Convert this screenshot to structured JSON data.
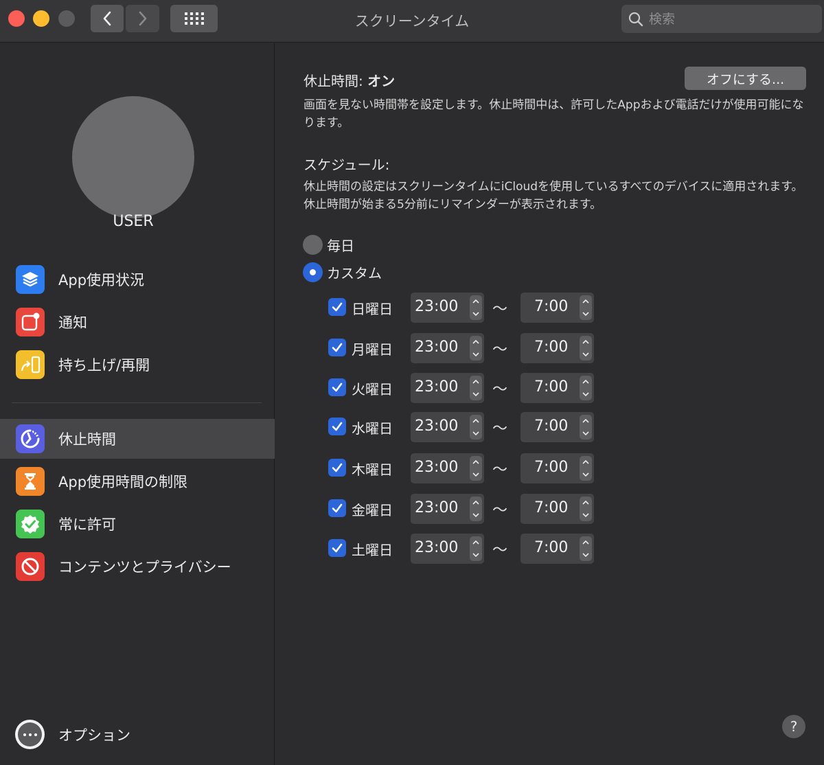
{
  "window": {
    "title": "スクリーンタイム"
  },
  "search": {
    "placeholder": "検索"
  },
  "user": {
    "name": "USER"
  },
  "sidebar": {
    "items": [
      {
        "label": "App使用状況",
        "icon": "layers-icon",
        "color": "#2d7cf0"
      },
      {
        "label": "通知",
        "icon": "notification-icon",
        "color": "#e9473e"
      },
      {
        "label": "持ち上げ/再開",
        "icon": "pickup-icon",
        "color": "#f2be2c"
      }
    ],
    "items2": [
      {
        "label": "休止時間",
        "icon": "downtime-icon",
        "color": "#5a5ee0",
        "selected": true
      },
      {
        "label": "App使用時間の制限",
        "icon": "hourglass-icon",
        "color": "#f0852a"
      },
      {
        "label": "常に許可",
        "icon": "checkmark-badge-icon",
        "color": "#45c353"
      },
      {
        "label": "コンテンツとプライバシー",
        "icon": "restriction-icon",
        "color": "#e23c34"
      }
    ],
    "options_label": "オプション"
  },
  "downtime": {
    "status_label": "休止時間:",
    "status_value": "オン",
    "off_button": "オフにする...",
    "description": "画面を見ない時間帯を設定します。休止時間中は、許可したAppおよび電話だけが使用可能になります。",
    "schedule_title": "スケジュール:",
    "schedule_description": "休止時間の設定はスクリーンタイムにiCloudを使用しているすべてのデバイスに適用されます。休止時間が始まる5分前にリマインダーが表示されます。",
    "radio_everyday": "毎日",
    "radio_custom": "カスタム",
    "selected_option": "カスタム",
    "separator": "〜",
    "days": [
      {
        "label": "日曜日",
        "checked": true,
        "start": "23:00",
        "end": "7:00"
      },
      {
        "label": "月曜日",
        "checked": true,
        "start": "23:00",
        "end": "7:00"
      },
      {
        "label": "火曜日",
        "checked": true,
        "start": "23:00",
        "end": "7:00"
      },
      {
        "label": "水曜日",
        "checked": true,
        "start": "23:00",
        "end": "7:00"
      },
      {
        "label": "木曜日",
        "checked": true,
        "start": "23:00",
        "end": "7:00"
      },
      {
        "label": "金曜日",
        "checked": true,
        "start": "23:00",
        "end": "7:00"
      },
      {
        "label": "土曜日",
        "checked": true,
        "start": "23:00",
        "end": "7:00"
      }
    ],
    "help": "?"
  }
}
